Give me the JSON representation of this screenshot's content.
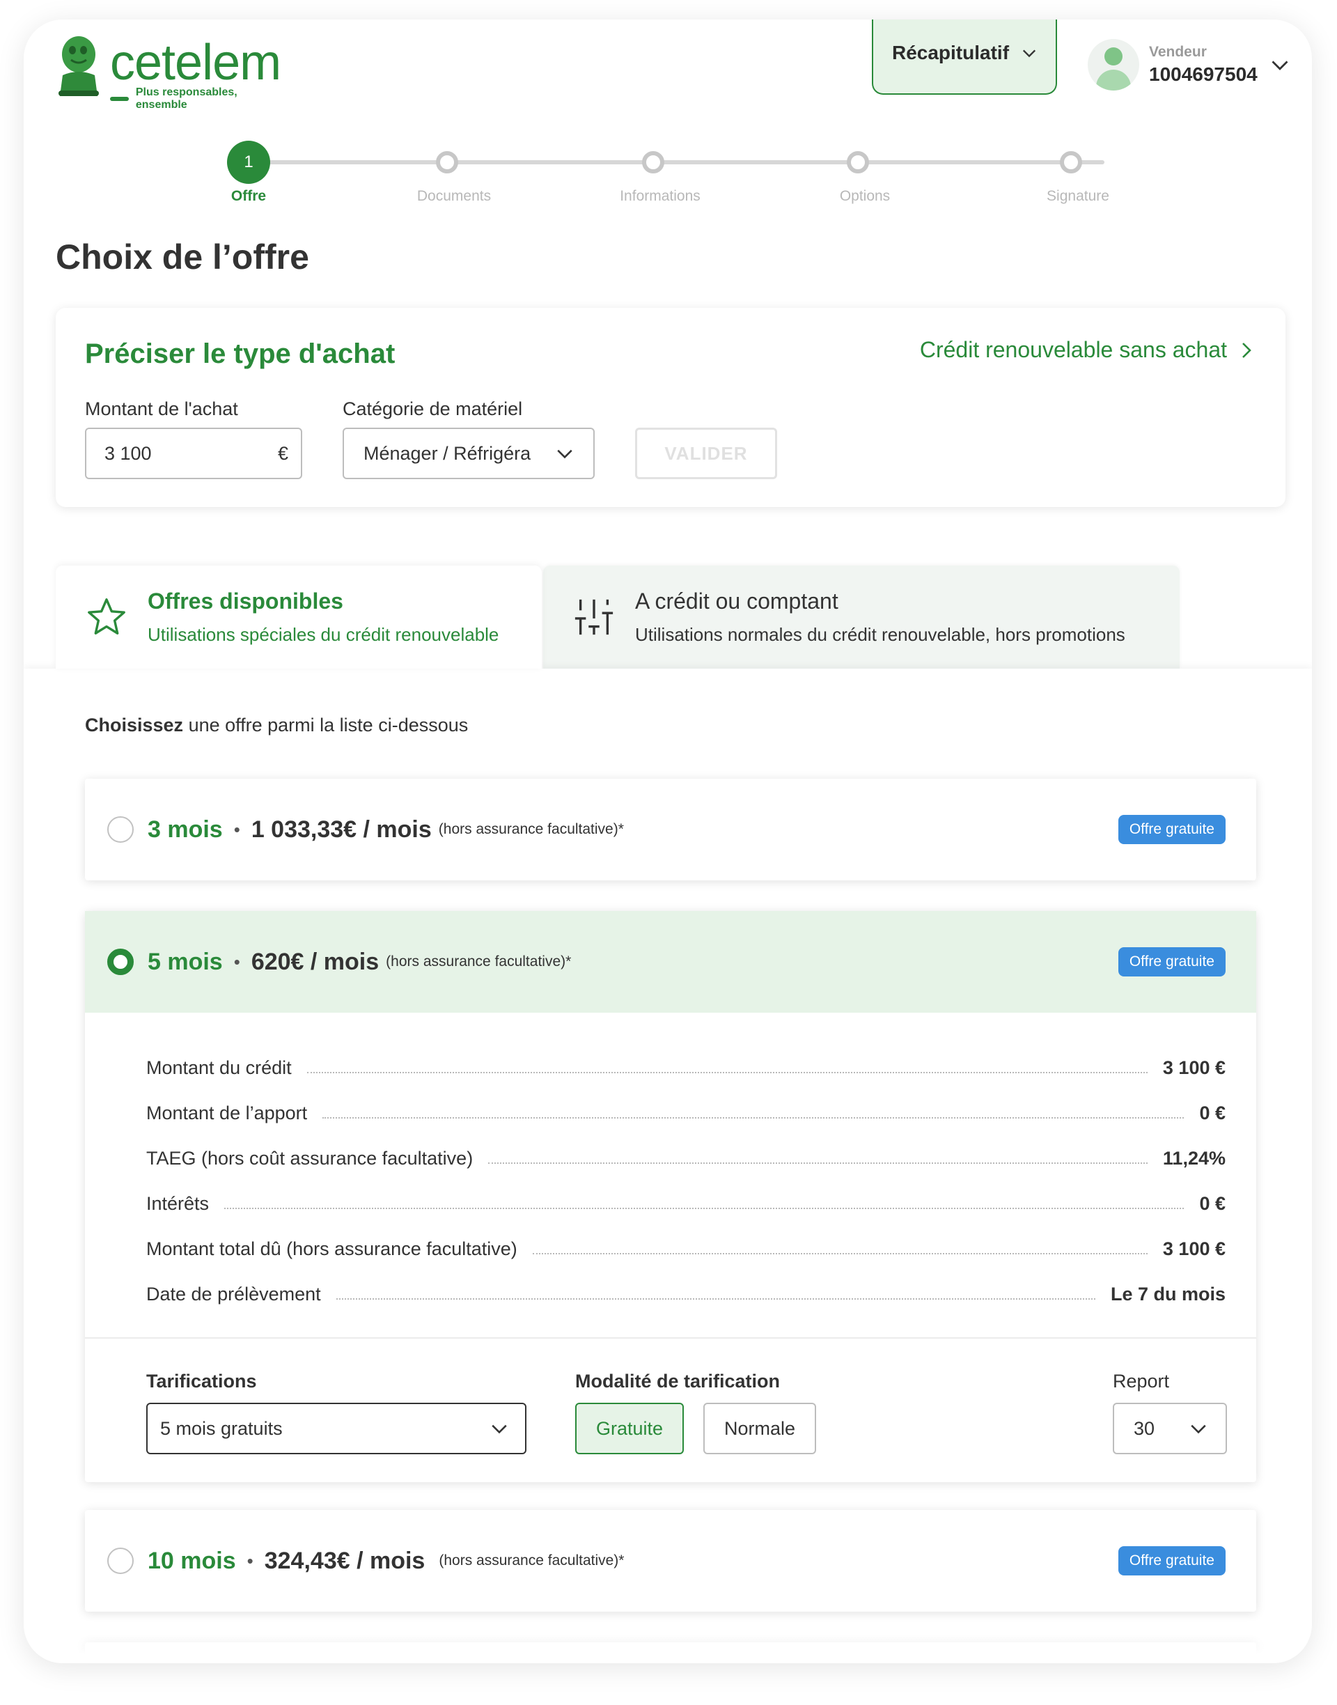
{
  "brand": {
    "name": "cetelem",
    "tagline": "Plus responsables, ensemble",
    "color": "#2a8a3a"
  },
  "header": {
    "recap_label": "Récapitulatif",
    "vendor_label": "Vendeur",
    "vendor_id": "1004697504"
  },
  "stepper": {
    "active_number": "1",
    "steps": [
      {
        "label": "Offre",
        "active": true
      },
      {
        "label": "Documents",
        "active": false
      },
      {
        "label": "Informations",
        "active": false
      },
      {
        "label": "Options",
        "active": false
      },
      {
        "label": "Signature",
        "active": false
      }
    ]
  },
  "page_title": "Choix de l’offre",
  "purchase": {
    "title": "Préciser le type d'achat",
    "renew_link": "Crédit renouvelable sans achat",
    "amount_label": "Montant de l'achat",
    "amount_value": "3 100",
    "currency": "€",
    "category_label": "Catégorie de matériel",
    "category_value": "Ménager / Réfrigéra",
    "validate_label": "VALIDER"
  },
  "tabs": [
    {
      "title": "Offres disponibles",
      "subtitle": "Utilisations spéciales du crédit renouvelable",
      "icon": "star-icon",
      "active": true
    },
    {
      "title": "A crédit ou comptant",
      "subtitle": "Utilisations normales du crédit renouvelable, hors promotions",
      "icon": "sliders-icon",
      "active": false
    }
  ],
  "offers_intro": {
    "bold": "Choisissez",
    "rest": " une offre parmi la liste ci-dessous"
  },
  "offers": [
    {
      "months": "3 mois",
      "price": "1 033,33€ / mois",
      "note": "(hors assurance facultative)*",
      "badge": "Offre gratuite",
      "selected": false
    },
    {
      "months": "5 mois",
      "price": "620€ / mois",
      "note": "(hors assurance facultative)*",
      "badge": "Offre gratuite",
      "selected": true
    },
    {
      "months": "10 mois",
      "price": "324,43€ / mois",
      "note": "(hors assurance facultative)*",
      "badge": "Offre gratuite",
      "selected": false
    }
  ],
  "separator": "•",
  "details": [
    {
      "label": "Montant du crédit",
      "value": "3 100 €"
    },
    {
      "label": "Montant de l’apport",
      "value": "0 €"
    },
    {
      "label": "TAEG (hors coût assurance facultative)",
      "value": "11,24%"
    },
    {
      "label": "Intérêts",
      "value": "0 €"
    },
    {
      "label": "Montant total dû (hors assurance facultative)",
      "value": "3 100 €"
    },
    {
      "label": "Date de prélèvement",
      "value": "Le 7 du mois"
    }
  ],
  "tarification": {
    "label": "Tarifications",
    "value": "5 mois gratuits",
    "modality_label": "Modalité de tarification",
    "modality_options": [
      "Gratuite",
      "Normale"
    ],
    "modality_selected": "Gratuite",
    "report_label": "Report",
    "report_value": "30"
  },
  "colors": {
    "accent": "#2a8a3a",
    "selected_bg": "#e6f3e7",
    "badge": "#3a8dde"
  }
}
